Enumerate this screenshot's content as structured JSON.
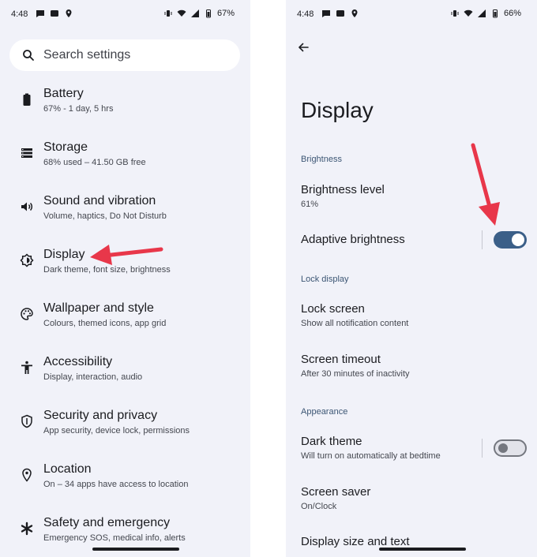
{
  "left_screen": {
    "status": {
      "time": "4:48",
      "battery": "67%"
    },
    "search": {
      "label": "Search settings"
    },
    "items": [
      {
        "title": "Battery",
        "subtitle": "67% - 1 day, 5 hrs"
      },
      {
        "title": "Storage",
        "subtitle": "68% used – 41.50 GB free"
      },
      {
        "title": "Sound and vibration",
        "subtitle": "Volume, haptics, Do Not Disturb"
      },
      {
        "title": "Display",
        "subtitle": "Dark theme, font size, brightness"
      },
      {
        "title": "Wallpaper and style",
        "subtitle": "Colours, themed icons, app grid"
      },
      {
        "title": "Accessibility",
        "subtitle": "Display, interaction, audio"
      },
      {
        "title": "Security and privacy",
        "subtitle": "App security, device lock, permissions"
      },
      {
        "title": "Location",
        "subtitle": "On – 34 apps have access to location"
      },
      {
        "title": "Safety and emergency",
        "subtitle": "Emergency SOS, medical info, alerts"
      }
    ]
  },
  "right_screen": {
    "status": {
      "time": "4:48",
      "battery": "66%"
    },
    "title": "Display",
    "sections": {
      "brightness": "Brightness",
      "lock_display": "Lock display",
      "appearance": "Appearance"
    },
    "items": {
      "brightness_level": {
        "title": "Brightness level",
        "subtitle": "61%"
      },
      "adaptive_brightness": {
        "title": "Adaptive brightness",
        "enabled": true
      },
      "lock_screen": {
        "title": "Lock screen",
        "subtitle": "Show all notification content"
      },
      "screen_timeout": {
        "title": "Screen timeout",
        "subtitle": "After 30 minutes of inactivity"
      },
      "dark_theme": {
        "title": "Dark theme",
        "subtitle": "Will turn on automatically at bedtime",
        "enabled": false
      },
      "screen_saver": {
        "title": "Screen saver",
        "subtitle": "On/Clock"
      },
      "display_size": {
        "title": "Display size and text"
      }
    }
  },
  "colors": {
    "background": "#f1f2f9",
    "accent": "#3b5f88",
    "annotation_arrow": "#e8374a"
  }
}
